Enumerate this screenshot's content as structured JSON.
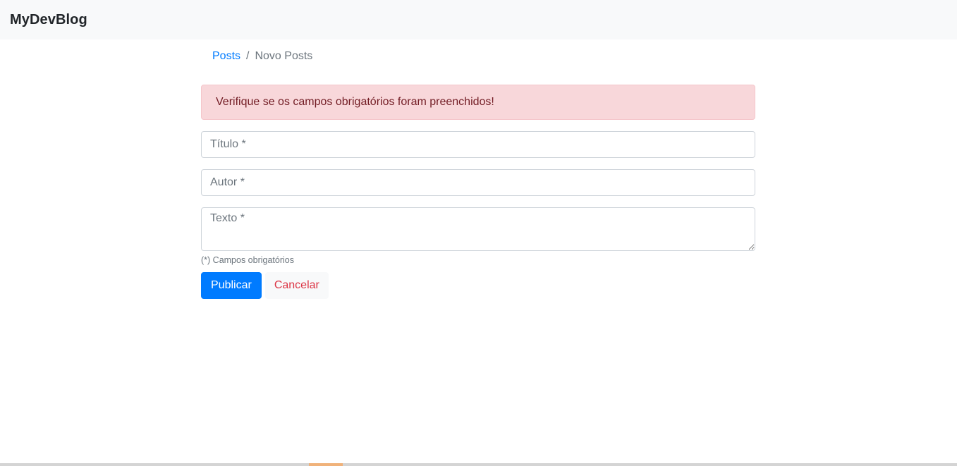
{
  "navbar": {
    "brand": "MyDevBlog"
  },
  "breadcrumb": {
    "items": [
      {
        "label": "Posts",
        "active": false
      },
      {
        "label": "Novo Posts",
        "active": true
      }
    ],
    "separator": "/"
  },
  "alert": {
    "message": "Verifique se os campos obrigatórios foram preenchidos!",
    "type": "danger"
  },
  "form": {
    "title_field": {
      "placeholder": "Título *",
      "value": ""
    },
    "author_field": {
      "placeholder": "Autor *",
      "value": ""
    },
    "text_field": {
      "placeholder": "Texto *",
      "value": ""
    },
    "required_hint": "(*) Campos obrigatórios",
    "submit_label": "Publicar",
    "cancel_label": "Cancelar"
  },
  "colors": {
    "primary": "#007bff",
    "danger": "#dc3545",
    "alert_bg": "#f8d7da",
    "alert_text": "#721c24",
    "navbar_bg": "#f8f9fa"
  }
}
